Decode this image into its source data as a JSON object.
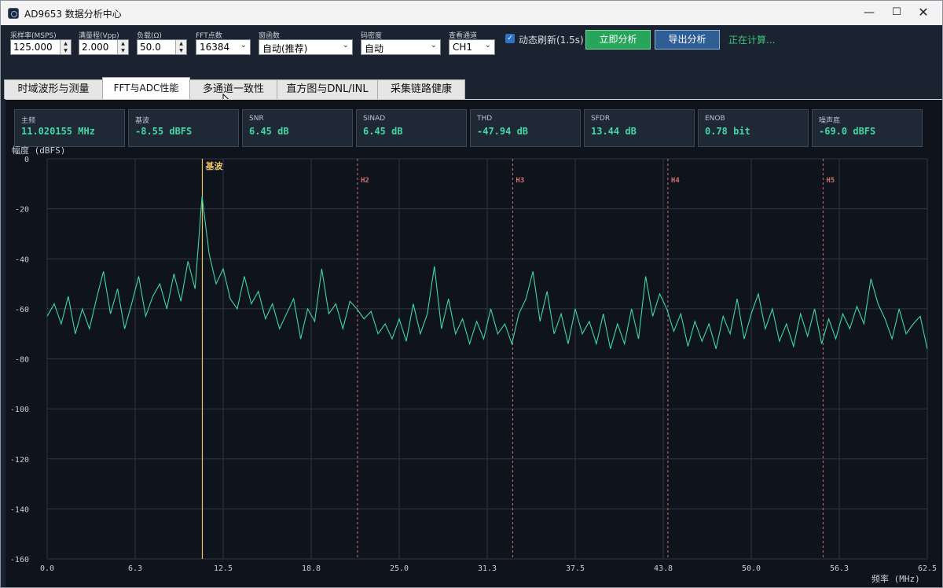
{
  "window": {
    "title": "AD9653 数据分析中心",
    "minimize_glyph": "—",
    "maximize_glyph": "☐",
    "close_glyph": "✕"
  },
  "toolbar": {
    "sample_rate": {
      "label": "采样率(MSPS)",
      "value": "125.000"
    },
    "full_scale": {
      "label": "满量程(Vpp)",
      "value": "2.000"
    },
    "load": {
      "label": "负载(Ω)",
      "value": "50.0"
    },
    "fft_points": {
      "label": "FFT点数",
      "value": "16384"
    },
    "window_fn": {
      "label": "窗函数",
      "value": "自动(推荐)"
    },
    "code_density": {
      "label": "码密度",
      "value": "自动"
    },
    "channel": {
      "label": "查看通道",
      "value": "CH1"
    },
    "auto_refresh": {
      "label": "动态刷新(1.5s)",
      "checked": true
    },
    "analyze_label": "立即分析",
    "export_label": "导出分析",
    "status_text": "正在计算..."
  },
  "tabs": [
    {
      "label": "时域波形与测量",
      "active": false
    },
    {
      "label": "FFT与ADC性能",
      "active": true
    },
    {
      "label": "多通道一致性",
      "active": false
    },
    {
      "label": "直方图与DNL/INL",
      "active": false
    },
    {
      "label": "采集链路健康",
      "active": false
    }
  ],
  "metrics": [
    {
      "label": "主频",
      "value": "11.020155 MHz"
    },
    {
      "label": "基波",
      "value": "-8.55 dBFS"
    },
    {
      "label": "SNR",
      "value": "6.45 dB"
    },
    {
      "label": "SINAD",
      "value": "6.45 dB"
    },
    {
      "label": "THD",
      "value": "-47.94 dB"
    },
    {
      "label": "SFDR",
      "value": "13.44 dB"
    },
    {
      "label": "ENOB",
      "value": "0.78 bit"
    },
    {
      "label": "噪声底",
      "value": "-69.0 dBFS"
    }
  ],
  "colors": {
    "trace": "#3fd8a4",
    "fundamental": "#e8c36a",
    "harmonic": "#d07070",
    "grid": "#2e3744",
    "axis_text": "#c8d0da"
  },
  "chart_data": {
    "type": "line",
    "ylabel": "幅度 (dBFS)",
    "xlabel": "频率 (MHz)",
    "xlim": [
      0,
      62.5
    ],
    "ylim": [
      -160,
      0
    ],
    "x_ticks": [
      "0.0",
      "6.3",
      "12.5",
      "18.8",
      "25.0",
      "31.3",
      "37.5",
      "43.8",
      "50.0",
      "56.3",
      "62.5"
    ],
    "y_ticks": [
      "0",
      "-20",
      "-40",
      "-60",
      "-80",
      "-100",
      "-120",
      "-140",
      "-160"
    ],
    "grid": true,
    "markers": [
      {
        "name": "基波",
        "x": 11.02
      },
      {
        "name": "H2",
        "x": 22.04
      },
      {
        "name": "H3",
        "x": 33.06
      },
      {
        "name": "H4",
        "x": 44.08
      },
      {
        "name": "H5",
        "x": 55.1
      }
    ],
    "series": [
      {
        "x": [
          0.0,
          0.5,
          1.0,
          1.5,
          2.0,
          2.5,
          3.0,
          3.5,
          4.0,
          4.5,
          5.0,
          5.5,
          6.0,
          6.5,
          7.0,
          7.5,
          8.0,
          8.5,
          9.0,
          9.5,
          10.0,
          10.5,
          11.0,
          11.5,
          12.0,
          12.5,
          13.0,
          13.5,
          14.0,
          14.5,
          15.0,
          15.5,
          16.0,
          16.5,
          17.0,
          17.5,
          18.0,
          18.5,
          19.0,
          19.5,
          20.0,
          20.5,
          21.0,
          21.5,
          22.0,
          22.5,
          23.0,
          23.5,
          24.0,
          24.5,
          25.0,
          25.5,
          26.0,
          26.5,
          27.0,
          27.5,
          28.0,
          28.5,
          29.0,
          29.5,
          30.0,
          30.5,
          31.0,
          31.5,
          32.0,
          32.5,
          33.0,
          33.5,
          34.0,
          34.5,
          35.0,
          35.5,
          36.0,
          36.5,
          37.0,
          37.5,
          38.0,
          38.5,
          39.0,
          39.5,
          40.0,
          40.5,
          41.0,
          41.5,
          42.0,
          42.5,
          43.0,
          43.5,
          44.0,
          44.5,
          45.0,
          45.5,
          46.0,
          46.5,
          47.0,
          47.5,
          48.0,
          48.5,
          49.0,
          49.5,
          50.0,
          50.5,
          51.0,
          51.5,
          52.0,
          52.5,
          53.0,
          53.5,
          54.0,
          54.5,
          55.0,
          55.5,
          56.0,
          56.5,
          57.0,
          57.5,
          58.0,
          58.5,
          59.0,
          59.5,
          60.0,
          60.5,
          61.0,
          61.5,
          62.0,
          62.5
        ],
        "values": [
          -63,
          -58,
          -66,
          -55,
          -70,
          -60,
          -68,
          -56,
          -45,
          -62,
          -52,
          -68,
          -58,
          -47,
          -63,
          -55,
          -50,
          -60,
          -46,
          -57,
          -41,
          -52,
          -15,
          -38,
          -50,
          -44,
          -56,
          -60,
          -47,
          -58,
          -53,
          -64,
          -58,
          -68,
          -62,
          -56,
          -72,
          -60,
          -65,
          -44,
          -62,
          -58,
          -68,
          -57,
          -60,
          -64,
          -61,
          -70,
          -66,
          -72,
          -64,
          -73,
          -58,
          -70,
          -62,
          -43,
          -68,
          -56,
          -70,
          -64,
          -74,
          -65,
          -72,
          -60,
          -70,
          -66,
          -74,
          -62,
          -56,
          -45,
          -65,
          -53,
          -70,
          -62,
          -74,
          -60,
          -70,
          -65,
          -74,
          -62,
          -76,
          -66,
          -74,
          -60,
          -72,
          -47,
          -63,
          -54,
          -60,
          -69,
          -62,
          -75,
          -65,
          -73,
          -66,
          -76,
          -63,
          -70,
          -56,
          -72,
          -62,
          -54,
          -68,
          -60,
          -73,
          -66,
          -75,
          -62,
          -71,
          -60,
          -74,
          -64,
          -72,
          -62,
          -68,
          -59,
          -66,
          -48,
          -58,
          -64,
          -72,
          -60,
          -70,
          -66,
          -63,
          -76
        ]
      }
    ]
  }
}
